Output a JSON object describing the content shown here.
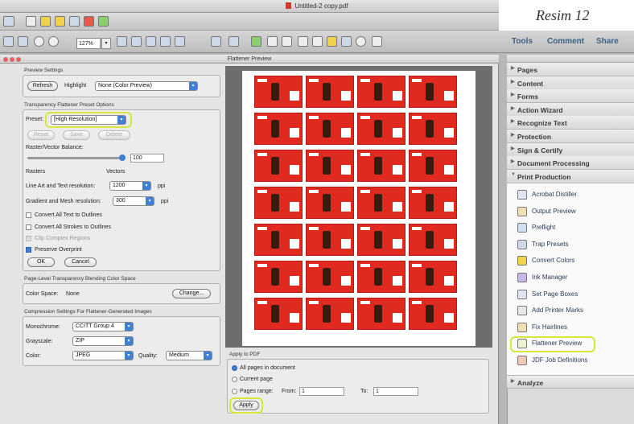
{
  "window": {
    "title": "Untitled-2 copy.pdf"
  },
  "caption": "Resim 12",
  "toolbar": {
    "zoom": "127%",
    "tools": "Tools",
    "comment": "Comment",
    "share": "Share"
  },
  "dialog": {
    "title": "Flattener Preview",
    "preview_settings": {
      "header": "Preview Settings",
      "refresh": "Refresh",
      "highlight_label": "Highlight",
      "highlight_value": "None (Color Preview)"
    },
    "preset_options": {
      "header": "Transparency Flattener Preset Options",
      "preset_label": "Preset:",
      "preset_value": "[High Resolution]",
      "reset": "Reset",
      "save": "Save",
      "delete": "Delete",
      "balance_label": "Raster/Vector Balance:",
      "balance_value": "100",
      "rasters": "Rasters",
      "vectors": "Vectors",
      "line_art_label": "Line Art and Text resolution:",
      "line_art_value": "1200",
      "line_art_unit": "ppi",
      "gradient_label": "Gradient and Mesh resolution:",
      "gradient_value": "300",
      "gradient_unit": "ppi",
      "convert_text": "Convert All Text to Outlines",
      "convert_strokes": "Convert All Strokes to Outlines",
      "clip_complex": "Clip Complex Regions",
      "preserve_overprint": "Preserve Overprint",
      "ok": "OK",
      "cancel": "Cancel"
    },
    "blending": {
      "header": "Page-Level Transparency Blending Color Space",
      "color_space_label": "Color Space:",
      "color_space_value": "None",
      "change": "Change..."
    },
    "compression": {
      "header": "Compression Settings For Flattener-Generated Images",
      "mono_label": "Monochrome:",
      "mono_value": "CCITT Group 4",
      "gray_label": "Grayscale:",
      "gray_value": "ZIP",
      "color_label": "Color:",
      "color_value": "JPEG",
      "quality_label": "Quality:",
      "quality_value": "Medium"
    },
    "apply_to_pdf": {
      "header": "Apply to PDF",
      "all_pages": "All pages in document",
      "current_page": "Current page",
      "pages_range": "Pages range:",
      "from_label": "From:",
      "from_value": "1",
      "to_label": "To:",
      "to_value": "1",
      "apply": "Apply"
    }
  },
  "panels": {
    "sections": [
      "Pages",
      "Content",
      "Forms",
      "Action Wizard",
      "Recognize Text",
      "Protection",
      "Sign & Certify",
      "Document Processing",
      "Print Production"
    ],
    "print_production_items": [
      "Acrobat Distiller",
      "Output Preview",
      "Preflight",
      "Trap Presets",
      "Convert Colors",
      "Ink Manager",
      "Set Page Boxes",
      "Add Printer Marks",
      "Fix Hairlines",
      "Flattener Preview",
      "JDF Job Definitions"
    ],
    "analyze": "Analyze"
  },
  "colors": {
    "highlight": "#d6e63a",
    "accent": "#3f7fd6",
    "label_red": "#e02a1f"
  }
}
